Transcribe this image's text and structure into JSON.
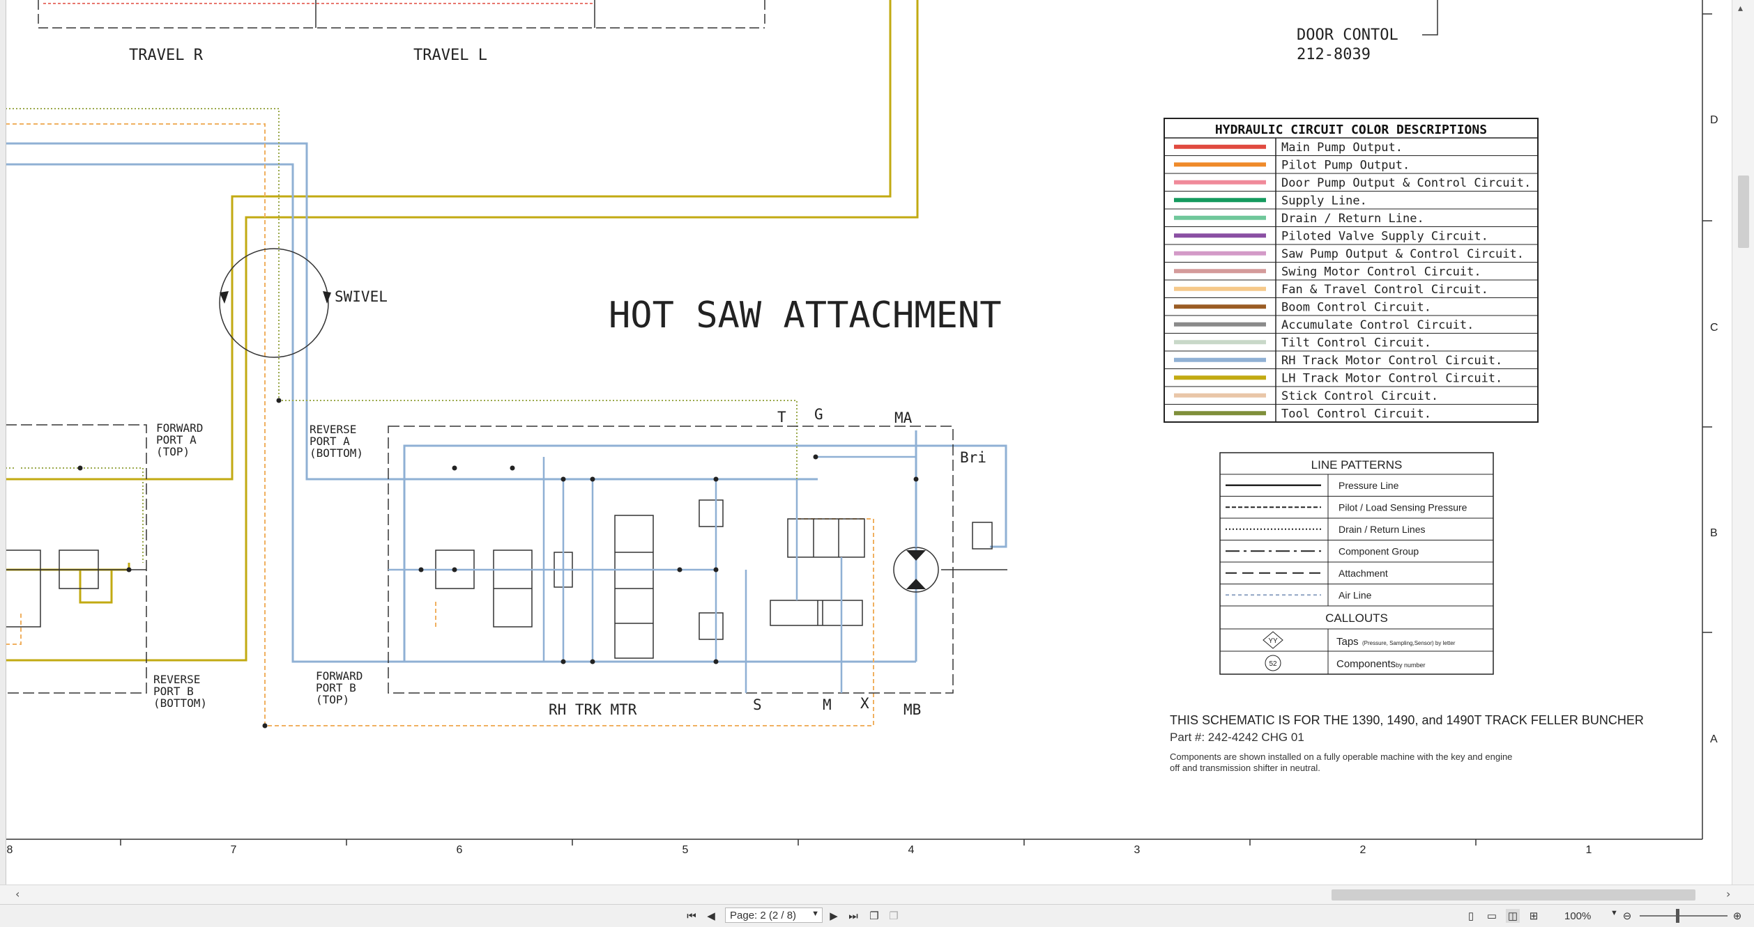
{
  "drawing": {
    "title": "HOT SAW ATTACHMENT",
    "top_labels": {
      "travel_r": "TRAVEL R",
      "travel_l": "TRAVEL L"
    },
    "door_control": {
      "line1": "DOOR CONTOL",
      "line2": "212-8039"
    },
    "swivel": "SWIVEL",
    "forward_port_a": [
      "FORWARD",
      "PORT A",
      "(TOP)"
    ],
    "reverse_port_a": [
      "REVERSE",
      "PORT A",
      "(BOTTOM)"
    ],
    "reverse_port_b": [
      "REVERSE",
      "PORT B",
      "(BOTTOM)"
    ],
    "forward_port_b": [
      "FORWARD",
      "PORT B",
      "(TOP)"
    ],
    "motor_label": "RH TRK MTR",
    "port_labels": {
      "t": "T",
      "g": "G",
      "ma": "MA",
      "s": "S",
      "m": "M",
      "x": "X",
      "mb": "MB",
      "bri": "Bri"
    }
  },
  "color_legend": {
    "title": "HYDRAULIC CIRCUIT COLOR DESCRIPTIONS",
    "rows": [
      {
        "label": "Main Pump Output.",
        "color": "#e04a3f"
      },
      {
        "label": "Pilot Pump Output.",
        "color": "#ef8a2a"
      },
      {
        "label": "Door Pump Output & Control Circuit.",
        "color": "#f08a9a"
      },
      {
        "label": "Supply Line.",
        "color": "#159a5e"
      },
      {
        "label": "Drain / Return Line.",
        "color": "#6fc79a"
      },
      {
        "label": "Piloted Valve Supply Circuit.",
        "color": "#8a4fa3"
      },
      {
        "label": "Saw Pump Output & Control Circuit.",
        "color": "#d39ac7"
      },
      {
        "label": "Swing Motor Control Circuit.",
        "color": "#d49a9a"
      },
      {
        "label": "Fan & Travel Control Circuit.",
        "color": "#f6c98a"
      },
      {
        "label": "Boom Control Circuit.",
        "color": "#9a5c24"
      },
      {
        "label": "Accumulate Control Circuit.",
        "color": "#8a8a8a"
      },
      {
        "label": "Tilt Control Circuit.",
        "color": "#c8d8c8"
      },
      {
        "label": "RH Track Motor Control Circuit.",
        "color": "#8fb0d4"
      },
      {
        "label": "LH Track Motor Control Circuit.",
        "color": "#c2aa12"
      },
      {
        "label": "Stick Control Circuit.",
        "color": "#e9c6a8"
      },
      {
        "label": "Tool Control Circuit.",
        "color": "#7f8f3a"
      }
    ]
  },
  "line_patterns": {
    "title": "LINE PATTERNS",
    "rows": [
      {
        "label": "Pressure Line",
        "pattern": "solid"
      },
      {
        "label": "Pilot / Load Sensing Pressure",
        "pattern": "dashed"
      },
      {
        "label": "Drain / Return Lines",
        "pattern": "dotted"
      },
      {
        "label": "Component Group",
        "pattern": "dash-dot"
      },
      {
        "label": "Attachment",
        "pattern": "long-dash"
      },
      {
        "label": "Air Line",
        "pattern": "air"
      }
    ],
    "callouts_title": "CALLOUTS",
    "taps": {
      "symbol": "YY",
      "label": "Taps",
      "note": "(Pressure, Sampling,Sensor) by letter"
    },
    "components": {
      "symbol": "52",
      "label": "Components",
      "note": "by number"
    }
  },
  "notes": {
    "schematic": "THIS SCHEMATIC IS FOR THE 1390, 1490, and 1490T TRACK FELLER BUNCHER",
    "part": "Part #: 242-4242 CHG 01",
    "line1": "Components are shown installed on a fully operable machine with the key and engine",
    "line2": "off and transmission shifter in neutral."
  },
  "grid": {
    "columns": [
      "8",
      "7",
      "6",
      "5",
      "4",
      "3",
      "2",
      "1"
    ],
    "rows": [
      "D",
      "C",
      "B",
      "A"
    ]
  },
  "statusbar": {
    "page": "Page: 2 (2 / 8)",
    "zoom": "100%"
  }
}
